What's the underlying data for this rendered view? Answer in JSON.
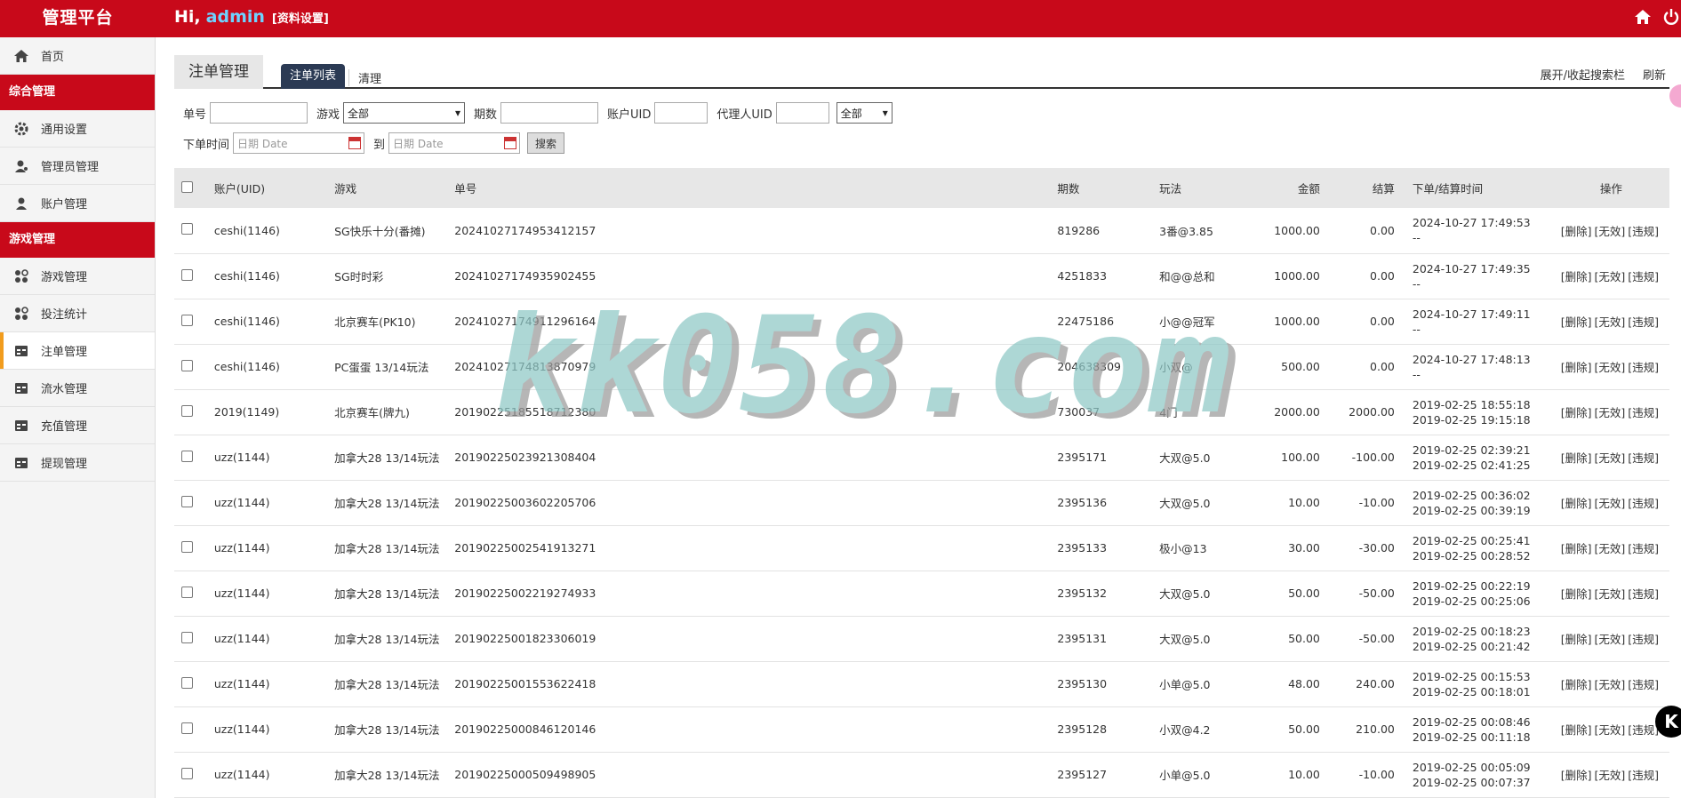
{
  "header": {
    "brand": "管理平台",
    "greeting": "Hi,",
    "username": "admin",
    "profile_link": "[资料设置]",
    "icons": [
      "home-icon",
      "power-icon"
    ]
  },
  "sidebar": {
    "home": "首页",
    "section1": "综合管理",
    "items1": [
      "通用设置",
      "管理员管理",
      "账户管理"
    ],
    "section2": "游戏管理",
    "items2": [
      "游戏管理",
      "投注统计",
      "注单管理",
      "流水管理",
      "充值管理",
      "提现管理"
    ],
    "active": "注单管理"
  },
  "main": {
    "page_title": "注单管理",
    "tab_active": "注单列表",
    "tab_clear": "清理",
    "toggle_search": "展开/收起搜索栏",
    "refresh": "刷新"
  },
  "filters": {
    "order_no_label": "单号",
    "game_label": "游戏",
    "game_value": "全部",
    "period_label": "期数",
    "account_uid_label": "账户UID",
    "agent_uid_label": "代理人UID",
    "agent_select_value": "全部",
    "time_label": "下单时间",
    "date_placeholder_from": "日期 Date",
    "to_label": "到",
    "date_placeholder_to": "日期 Date",
    "search_button": "搜索"
  },
  "table": {
    "columns": [
      "账户(UID)",
      "游戏",
      "单号",
      "期数",
      "玩法",
      "金额",
      "结算",
      "下单/结算时间",
      "操作"
    ],
    "actions": [
      "[删除]",
      "[无效]",
      "[违规]"
    ],
    "rows": [
      {
        "account": "ceshi(1146)",
        "game": "SG快乐十分(番摊)",
        "order": "20241027174953412157",
        "period": "819286",
        "play": "3番@3.85",
        "amount": "1000.00",
        "settle": "0.00",
        "t1": "2024-10-27 17:49:53",
        "t2": "--"
      },
      {
        "account": "ceshi(1146)",
        "game": "SG时时彩",
        "order": "20241027174935902455",
        "period": "4251833",
        "play": "和@@总和",
        "amount": "1000.00",
        "settle": "0.00",
        "t1": "2024-10-27 17:49:35",
        "t2": "--"
      },
      {
        "account": "ceshi(1146)",
        "game": "北京赛车(PK10)",
        "order": "20241027174911296164",
        "period": "22475186",
        "play": "小@@冠军",
        "amount": "1000.00",
        "settle": "0.00",
        "t1": "2024-10-27 17:49:11",
        "t2": "--"
      },
      {
        "account": "ceshi(1146)",
        "game": "PC蛋蛋 13/14玩法",
        "order": "20241027174813870979",
        "period": "204638309",
        "play": "小双@",
        "amount": "500.00",
        "settle": "0.00",
        "t1": "2024-10-27 17:48:13",
        "t2": "--"
      },
      {
        "account": "2019(1149)",
        "game": "北京赛车(牌九)",
        "order": "20190225185518712380",
        "period": "730037",
        "play": "4门",
        "amount": "2000.00",
        "settle": "2000.00",
        "t1": "2019-02-25 18:55:18",
        "t2": "2019-02-25 19:15:18"
      },
      {
        "account": "uzz(1144)",
        "game": "加拿大28 13/14玩法",
        "order": "20190225023921308404",
        "period": "2395171",
        "play": "大双@5.0",
        "amount": "100.00",
        "settle": "-100.00",
        "t1": "2019-02-25 02:39:21",
        "t2": "2019-02-25 02:41:25"
      },
      {
        "account": "uzz(1144)",
        "game": "加拿大28 13/14玩法",
        "order": "20190225003602205706",
        "period": "2395136",
        "play": "大双@5.0",
        "amount": "10.00",
        "settle": "-10.00",
        "t1": "2019-02-25 00:36:02",
        "t2": "2019-02-25 00:39:19"
      },
      {
        "account": "uzz(1144)",
        "game": "加拿大28 13/14玩法",
        "order": "20190225002541913271",
        "period": "2395133",
        "play": "极小@13",
        "amount": "30.00",
        "settle": "-30.00",
        "t1": "2019-02-25 00:25:41",
        "t2": "2019-02-25 00:28:52"
      },
      {
        "account": "uzz(1144)",
        "game": "加拿大28 13/14玩法",
        "order": "20190225002219274933",
        "period": "2395132",
        "play": "大双@5.0",
        "amount": "50.00",
        "settle": "-50.00",
        "t1": "2019-02-25 00:22:19",
        "t2": "2019-02-25 00:25:06"
      },
      {
        "account": "uzz(1144)",
        "game": "加拿大28 13/14玩法",
        "order": "20190225001823306019",
        "period": "2395131",
        "play": "大双@5.0",
        "amount": "50.00",
        "settle": "-50.00",
        "t1": "2019-02-25 00:18:23",
        "t2": "2019-02-25 00:21:42"
      },
      {
        "account": "uzz(1144)",
        "game": "加拿大28 13/14玩法",
        "order": "20190225001553622418",
        "period": "2395130",
        "play": "小单@5.0",
        "amount": "48.00",
        "settle": "240.00",
        "t1": "2019-02-25 00:15:53",
        "t2": "2019-02-25 00:18:01"
      },
      {
        "account": "uzz(1144)",
        "game": "加拿大28 13/14玩法",
        "order": "20190225000846120146",
        "period": "2395128",
        "play": "小双@4.2",
        "amount": "50.00",
        "settle": "210.00",
        "t1": "2019-02-25 00:08:46",
        "t2": "2019-02-25 00:11:18"
      },
      {
        "account": "uzz(1144)",
        "game": "加拿大28 13/14玩法",
        "order": "20190225000509498905",
        "period": "2395127",
        "play": "小单@5.0",
        "amount": "10.00",
        "settle": "-10.00",
        "t1": "2019-02-25 00:05:09",
        "t2": "2019-02-25 00:07:37"
      }
    ]
  },
  "watermark": "kk058.com",
  "float_badge": "K"
}
